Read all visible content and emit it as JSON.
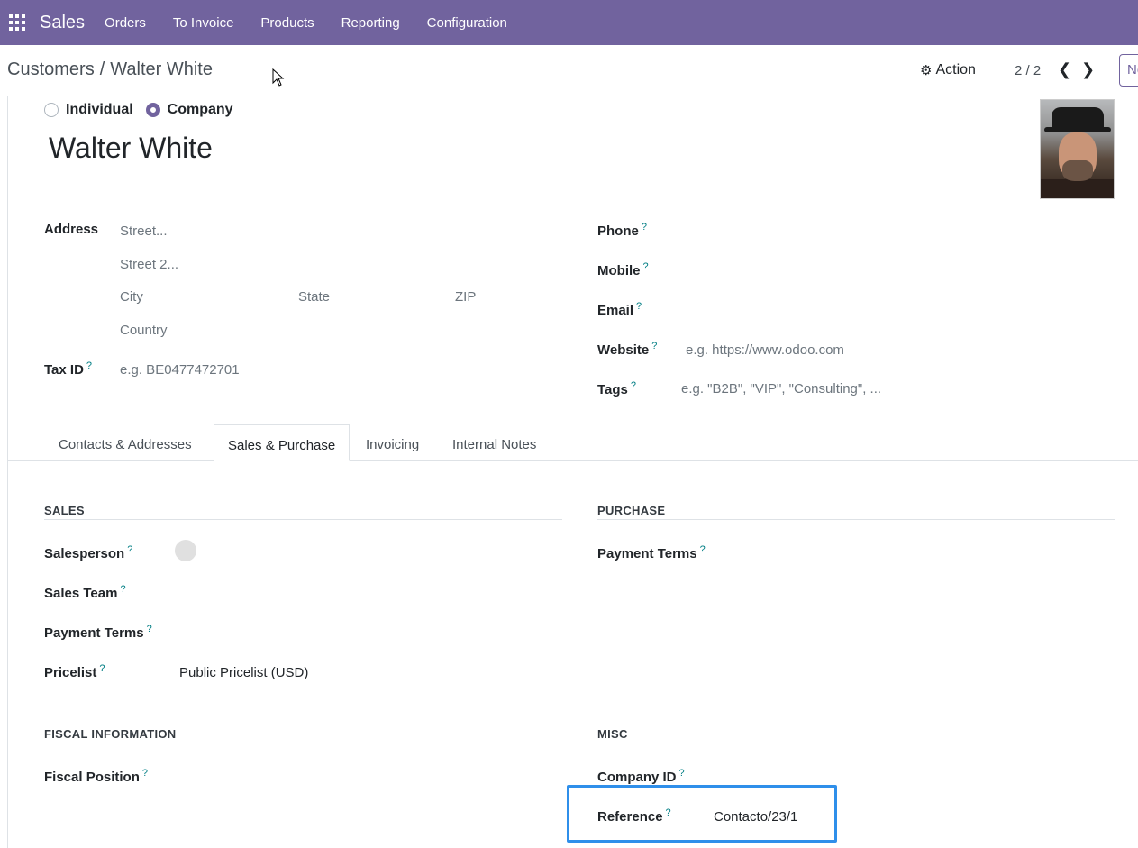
{
  "nav": {
    "brand": "Sales",
    "items": [
      "Orders",
      "To Invoice",
      "Products",
      "Reporting",
      "Configuration"
    ]
  },
  "control": {
    "breadcrumb_parent": "Customers",
    "breadcrumb_sep": "/",
    "breadcrumb_current": "Walter White",
    "action_label": "Action",
    "pager": "2 / 2",
    "new_label": "New"
  },
  "form": {
    "type_options": [
      "Individual",
      "Company"
    ],
    "type_selected": "Company",
    "name": "Walter White",
    "address": {
      "label": "Address",
      "street_ph": "Street...",
      "street2_ph": "Street 2...",
      "city_ph": "City",
      "state_ph": "State",
      "zip_ph": "ZIP",
      "country_ph": "Country"
    },
    "tax_id": {
      "label": "Tax ID",
      "placeholder": "e.g. BE0477472701"
    },
    "phone_label": "Phone",
    "mobile_label": "Mobile",
    "email_label": "Email",
    "website": {
      "label": "Website",
      "placeholder": "e.g. https://www.odoo.com"
    },
    "tags": {
      "label": "Tags",
      "placeholder": "e.g. \"B2B\", \"VIP\", \"Consulting\", ..."
    },
    "help_mark": "?"
  },
  "tabs": [
    "Contacts & Addresses",
    "Sales & Purchase",
    "Invoicing",
    "Internal Notes"
  ],
  "sales_purchase": {
    "sales_title": "SALES",
    "purchase_title": "PURCHASE",
    "salesperson_label": "Salesperson",
    "sales_team_label": "Sales Team",
    "payment_terms_label": "Payment Terms",
    "pricelist_label": "Pricelist",
    "pricelist_value": "Public Pricelist (USD)",
    "purchase_payment_terms_label": "Payment Terms",
    "fiscal_title": "FISCAL INFORMATION",
    "fiscal_position_label": "Fiscal Position",
    "misc_title": "MISC",
    "company_id_label": "Company ID",
    "reference_label": "Reference",
    "reference_value": "Contacto/23/1"
  },
  "colors": {
    "brand": "#71639e",
    "highlight": "#2f8fea",
    "help": "#017e84"
  }
}
